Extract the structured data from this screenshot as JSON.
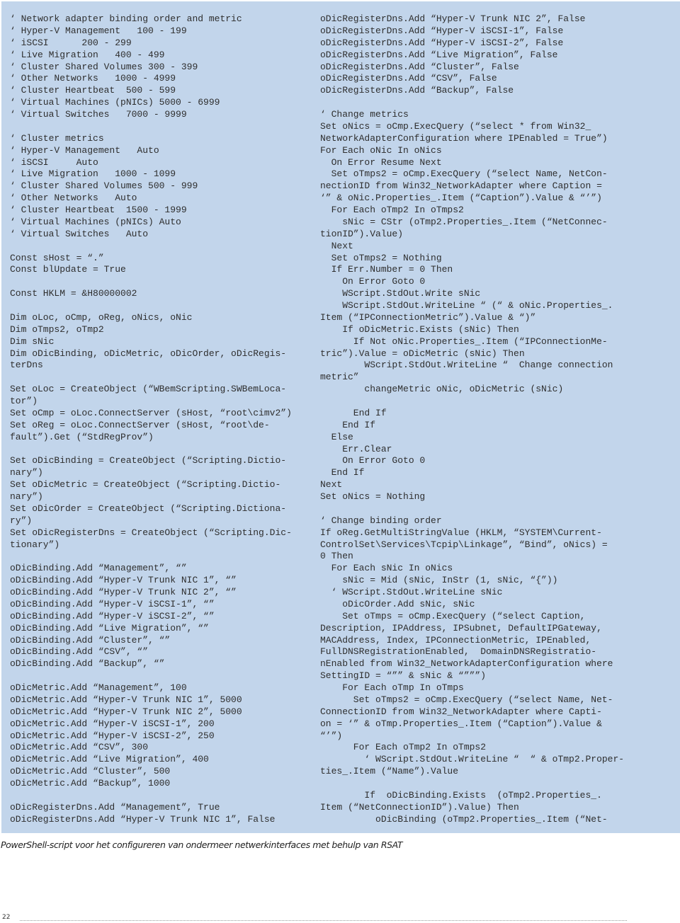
{
  "code": {
    "left_column": [
      "‘ Network adapter binding order and metric",
      "‘ Hyper-V Management   100 - 199",
      "‘ iSCSI      200 - 299",
      "‘ Live Migration   400 - 499",
      "‘ Cluster Shared Volumes 300 - 399",
      "‘ Other Networks   1000 - 4999",
      "‘ Cluster Heartbeat  500 - 599",
      "‘ Virtual Machines (pNICs) 5000 - 6999",
      "‘ Virtual Switches   7000 - 9999",
      "",
      "‘ Cluster metrics",
      "‘ Hyper-V Management   Auto",
      "‘ iSCSI     Auto",
      "‘ Live Migration   1000 - 1099",
      "‘ Cluster Shared Volumes 500 - 999",
      "‘ Other Networks   Auto",
      "‘ Cluster Heartbeat  1500 - 1999",
      "‘ Virtual Machines (pNICs) Auto",
      "‘ Virtual Switches   Auto",
      "",
      "Const sHost = “.”",
      "Const blUpdate = True",
      "",
      "Const HKLM = &H80000002",
      "",
      "Dim oLoc, oCmp, oReg, oNics, oNic",
      "Dim oTmps2, oTmp2",
      "Dim sNic",
      "Dim oDicBinding, oDicMetric, oDicOrder, oDicRegis-",
      "terDns",
      "",
      "Set oLoc = CreateObject (“WBemScripting.SWBemLoca-",
      "tor”)",
      "Set oCmp = oLoc.ConnectServer (sHost, “root\\cimv2”)",
      "Set oReg = oLoc.ConnectServer (sHost, “root\\de-",
      "fault”).Get (“StdRegProv”)",
      "",
      "Set oDicBinding = CreateObject (“Scripting.Dictio-",
      "nary”)",
      "Set oDicMetric = CreateObject (“Scripting.Dictio-",
      "nary”)",
      "Set oDicOrder = CreateObject (“Scripting.Dictiona-",
      "ry”)",
      "Set oDicRegisterDns = CreateObject (“Scripting.Dic-",
      "tionary”)",
      "",
      "oDicBinding.Add “Management”, “”",
      "oDicBinding.Add “Hyper-V Trunk NIC 1”, “”",
      "oDicBinding.Add “Hyper-V Trunk NIC 2”, “”",
      "oDicBinding.Add “Hyper-V iSCSI-1”, “”",
      "oDicBinding.Add “Hyper-V iSCSI-2”, “”",
      "oDicBinding.Add “Live Migration”, “”",
      "oDicBinding.Add “Cluster”, “”",
      "oDicBinding.Add “CSV”, “”",
      "oDicBinding.Add “Backup”, “”",
      "",
      "oDicMetric.Add “Management”, 100",
      "oDicMetric.Add “Hyper-V Trunk NIC 1”, 5000",
      "oDicMetric.Add “Hyper-V Trunk NIC 2”, 5000",
      "oDicMetric.Add “Hyper-V iSCSI-1”, 200",
      "oDicMetric.Add “Hyper-V iSCSI-2”, 250",
      "oDicMetric.Add “CSV”, 300",
      "oDicMetric.Add “Live Migration”, 400",
      "oDicMetric.Add “Cluster”, 500",
      "oDicMetric.Add “Backup”, 1000",
      "",
      "oDicRegisterDns.Add “Management”, True",
      "oDicRegisterDns.Add “Hyper-V Trunk NIC 1”, False"
    ],
    "right_column": [
      "oDicRegisterDns.Add “Hyper-V Trunk NIC 2”, False",
      "oDicRegisterDns.Add “Hyper-V iSCSI-1”, False",
      "oDicRegisterDns.Add “Hyper-V iSCSI-2”, False",
      "oDicRegisterDns.Add “Live Migration”, False",
      "oDicRegisterDns.Add “Cluster”, False",
      "oDicRegisterDns.Add “CSV”, False",
      "oDicRegisterDns.Add “Backup”, False",
      "",
      "‘ Change metrics",
      "Set oNics = oCmp.ExecQuery (“select * from Win32_",
      "NetworkAdapterConfiguration where IPEnabled = True”)",
      "For Each oNic In oNics",
      "  On Error Resume Next",
      "  Set oTmps2 = oCmp.ExecQuery (“select Name, NetCon-",
      "nectionID from Win32_NetworkAdapter where Caption =",
      "‘” & oNic.Properties_.Item (“Caption”).Value & “’”)",
      "  For Each oTmp2 In oTmps2",
      "    sNic = CStr (oTmp2.Properties_.Item (“NetConnec-",
      "tionID”).Value)",
      "  Next",
      "  Set oTmps2 = Nothing",
      "  If Err.Number = 0 Then",
      "    On Error Goto 0",
      "    WScript.StdOut.Write sNic",
      "    WScript.StdOut.WriteLine “ (“ & oNic.Properties_.",
      "Item (“IPConnectionMetric”).Value & “)”",
      "    If oDicMetric.Exists (sNic) Then",
      "      If Not oNic.Properties_.Item (“IPConnectionMe-",
      "tric”).Value = oDicMetric (sNic) Then",
      "        WScript.StdOut.WriteLine “  Change connection",
      "metric”",
      "        changeMetric oNic, oDicMetric (sNic)",
      "",
      "      End If",
      "    End If",
      "  Else",
      "    Err.Clear",
      "    On Error Goto 0",
      "  End If",
      "Next",
      "Set oNics = Nothing",
      "",
      "‘ Change binding order",
      "If oReg.GetMultiStringValue (HKLM, “SYSTEM\\Current-",
      "ControlSet\\Services\\Tcpip\\Linkage”, “Bind”, oNics) =",
      "0 Then",
      "  For Each sNic In oNics",
      "    sNic = Mid (sNic, InStr (1, sNic, “{”))",
      "  ‘ WScript.StdOut.WriteLine sNic",
      "    oDicOrder.Add sNic, sNic",
      "    Set oTmps = oCmp.ExecQuery (“select Caption,",
      "Description, IPAddress, IPSubnet, DefaultIPGateway,",
      "MACAddress, Index, IPConnectionMetric, IPEnabled,",
      "FullDNSRegistrationEnabled,  DomainDNSRegistratio-",
      "nEnabled from Win32_NetworkAdapterConfiguration where",
      "SettingID = “”” & sNic & “”””)",
      "    For Each oTmp In oTmps",
      "      Set oTmps2 = oCmp.ExecQuery (“select Name, Net-",
      "ConnectionID from Win32_NetworkAdapter where Capti-",
      "on = ‘” & oTmp.Properties_.Item (“Caption”).Value &",
      "“’”)",
      "      For Each oTmp2 In oTmps2",
      "        ‘ WScript.StdOut.WriteLine “  “ & oTmp2.Proper-",
      "ties_.Item (“Name”).Value",
      "",
      "        If  oDicBinding.Exists  (oTmp2.Properties_.",
      "Item (“NetConnectionID”).Value) Then",
      "          oDicBinding (oTmp2.Properties_.Item (“Net-"
    ]
  },
  "caption": "PowerShell-script voor het configureren van ondermeer netwerkinterfaces met behulp van RSAT",
  "page_number": "22",
  "colors": {
    "code_background": "#c2d5eb",
    "text": "#2e2e2e"
  }
}
